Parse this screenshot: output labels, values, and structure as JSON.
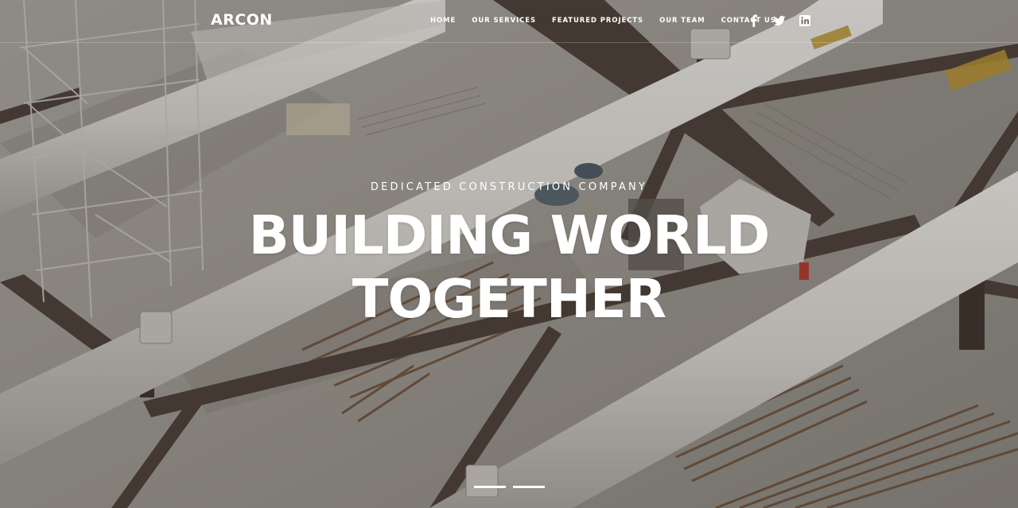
{
  "header": {
    "logo": "ARCON",
    "nav": [
      {
        "label": "HOME"
      },
      {
        "label": "OUR SERVICES"
      },
      {
        "label": "FEATURED PROJECTS"
      },
      {
        "label": "OUR TEAM"
      },
      {
        "label": "CONTACT US"
      }
    ],
    "social": [
      {
        "icon": "facebook-icon"
      },
      {
        "icon": "twitter-icon"
      },
      {
        "icon": "linkedin-icon"
      }
    ]
  },
  "hero": {
    "subtitle": "DEDICATED CONSTRUCTION COMPANY",
    "title_line1": "BUILDING WORLD",
    "title_line2": "TOGETHER",
    "slides_count": 2,
    "active_slide": 1
  },
  "colors": {
    "text": "#ffffff",
    "concrete": "#d9d5cf",
    "steel": "#5a4b40",
    "rust": "#7a4a2c"
  }
}
